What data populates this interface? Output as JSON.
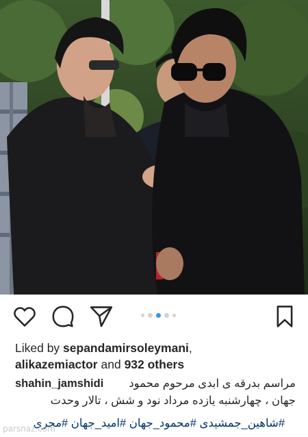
{
  "post": {
    "photo_alt": "",
    "carousel": {
      "count": 5,
      "active_index": 2
    },
    "icons": {
      "like": "heart-icon",
      "comment": "comment-bubble-icon",
      "share": "paper-plane-icon",
      "save": "bookmark-icon"
    },
    "likes": {
      "prefix": "Liked by ",
      "user1": "sepandamirsoleymani",
      "sep": ",",
      "user2": "alikazemiactor",
      "middle": " and ",
      "count": "932 others"
    },
    "caption": {
      "username": "shahin_jamshidi",
      "line1": "مراسم بدرقه ی ابدی مرحوم محمود",
      "line2": "جهان ، چهارشنبه یازده مرداد نود و شش ، تالار وحدت",
      "hashtags": "#شاهین_جمشیدی #محمود_جهان #امید_جهان #مجری"
    },
    "watermark": "parsnaz.com"
  }
}
